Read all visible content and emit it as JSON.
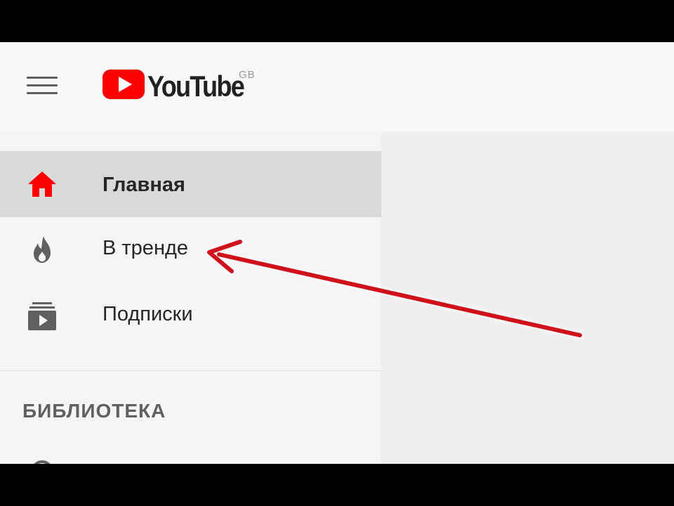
{
  "header": {
    "logo_text": "YouTube",
    "country_code": "GB",
    "brand_color": "#ff0000"
  },
  "sidebar": {
    "items": [
      {
        "label": "Главная",
        "icon": "home-icon",
        "active": true
      },
      {
        "label": "В тренде",
        "icon": "trending-flame-icon",
        "active": false
      },
      {
        "label": "Подписки",
        "icon": "subscriptions-icon",
        "active": false
      }
    ],
    "section_title": "БИБЛИОТЕКА",
    "active_icon_color": "#ff0000",
    "inactive_icon_color": "#606060"
  },
  "annotation": {
    "arrow_color": "#d0101b",
    "points_to": "В тренде"
  }
}
